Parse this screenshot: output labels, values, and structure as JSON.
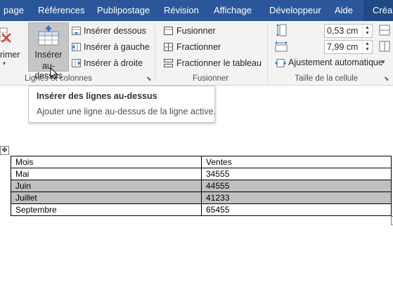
{
  "ribbon": {
    "tabs": [
      "page",
      "Références",
      "Publipostage",
      "Révision",
      "Affichage",
      "Développeur",
      "Aide",
      "Créa"
    ],
    "delete_label": "rimer",
    "insert_above": [
      "Insérer",
      "au-dessus"
    ],
    "insert_below": "Insérer dessous",
    "insert_left": "Insérer à gauche",
    "insert_right": "Insérer à droite",
    "merge": "Fusionner",
    "split": "Fractionner",
    "split_table": "Fractionner le tableau",
    "row_height": "0,53 cm",
    "col_width": "7,99 cm",
    "autofit": "Ajustement automatique",
    "groups": {
      "rows_cols": "Lignes et colonnes",
      "merge": "Fusionner",
      "cell_size": "Taille de la cellule"
    }
  },
  "tooltip": {
    "title": "Insérer des lignes au-dessus",
    "description": "Ajouter une ligne au-dessus de la ligne active."
  },
  "table": {
    "headers": [
      "Mois",
      "Ventes"
    ],
    "rows": [
      [
        "Mai",
        "34555"
      ],
      [
        "Juin",
        "44555"
      ],
      [
        "Juillet",
        "41233"
      ],
      [
        "Septembre",
        "65455"
      ]
    ],
    "selected_rows": [
      1,
      2
    ]
  },
  "colors": {
    "ribbon_tab_bar": "#2b579a",
    "ribbon_body": "#f3f3f3",
    "selection": "#c0c0c0"
  }
}
